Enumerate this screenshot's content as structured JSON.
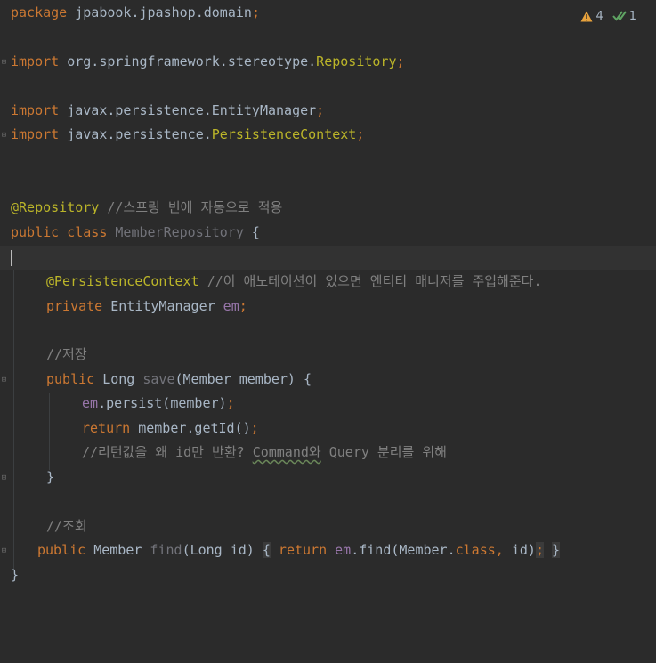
{
  "status": {
    "warnings": "4",
    "checks": "1"
  },
  "code": {
    "l1_kw": "package",
    "l1_rest": " jpabook.jpashop.domain",
    "l1_semi": ";",
    "l3_kw": "import",
    "l3_pkg": " org.springframework.stereotype.",
    "l3_cls": "Repository",
    "l3_semi": ";",
    "l5_kw": "import",
    "l5_pkg": " javax.persistence.EntityManager",
    "l5_semi": ";",
    "l6_kw": "import",
    "l6_pkg": " javax.persistence.",
    "l6_cls": "PersistenceContext",
    "l6_semi": ";",
    "l9_ann": "@Repository",
    "l9_cm": " //스프링 빈에 자동으로 적용",
    "l10_kw": "public class",
    "l10_cls": " MemberRepository",
    "l10_brace": " {",
    "l12_ann": "@PersistenceContext",
    "l12_cm": " //이 애노테이션이 있으면 엔티티 매니저를 주입해준다.",
    "l13_kw": "private",
    "l13_type": " EntityManager",
    "l13_fld": " em",
    "l13_semi": ";",
    "l15_cm": "//저장",
    "l16_kw": "public",
    "l16_type": " Long",
    "l16_name": " save",
    "l16_rest": "(Member member) {",
    "l17_fld": "em",
    "l17_rest": ".persist(member)",
    "l17_semi": ";",
    "l18_kw": "return",
    "l18_rest": " member.getId()",
    "l18_semi": ";",
    "l19_cm1": "//리턴값을 왜 id만 반환? ",
    "l19_typo": "Command와",
    "l19_cm2": " Query 분리를 위해",
    "l20_brace": "}",
    "l22_cm": "//조회",
    "l23_kw": "public",
    "l23_type": " Member",
    "l23_name": " find",
    "l23_params": "(Long id) ",
    "l23_lb": "{",
    "l23_kw2": " return",
    "l23_fld": " em",
    "l23_call": ".find(Member.",
    "l23_class": "class",
    "l23_comma": ",",
    "l23_id": " id)",
    "l23_semi": ";",
    "l23_rb": "}",
    "l24_brace": "}"
  }
}
